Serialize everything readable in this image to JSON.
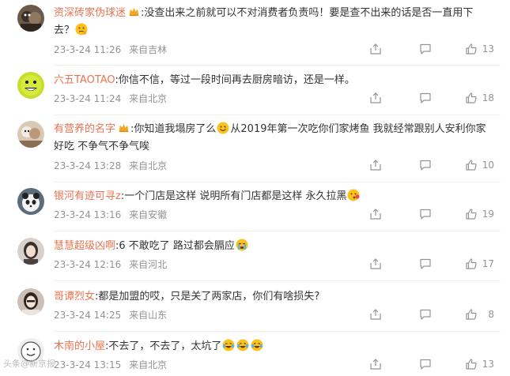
{
  "comments": [
    {
      "user": "资深砖家伪球迷",
      "verified": true,
      "text_parts": [
        ":没查出来之前就可以不对消费者负责吗！要是查不出来的话是否一直用下去？"
      ],
      "emojis_after": [
        "think-emoji"
      ],
      "timestamp": "23-3-24 11:26",
      "location": "来自吉林",
      "likes": "13",
      "avatar_color": "#6b5a48"
    },
    {
      "user": "六五TAOTAO",
      "verified": false,
      "text_parts": [
        ":你信不信，等过一段时间再去厨房暗访，还是一样。"
      ],
      "emojis_after": [],
      "timestamp": "23-3-24 11:24",
      "location": "来自北京",
      "likes": "18",
      "avatar_color": "#c8de2c"
    },
    {
      "user": "有营养的名字",
      "verified": true,
      "text_parts": [
        ":你知道我塌房了么",
        "从2019年第一次吃你们家烤鱼 我就经常跟别人安利你家好吃 不争气不争气唉"
      ],
      "emojis_after": [],
      "timestamp": "23-3-24 13:28",
      "location": "来自北京",
      "likes": "10",
      "avatar_color": "#d9c9b4"
    },
    {
      "user": "银河有迹可寻z",
      "verified": false,
      "text_parts": [
        ":一个门店是这样 说明所有门店都是这样 永久拉黑"
      ],
      "emojis_after": [
        "awkward-emoji"
      ],
      "timestamp": "23-3-24 13:16",
      "location": "来自安徽",
      "likes": "19",
      "avatar_color": "#5b6c7a"
    },
    {
      "user": "慧慧超级凶啊",
      "verified": false,
      "text_parts": [
        ":6 不敢吃了 路过都会膈应"
      ],
      "emojis_after": [
        "cry-emoji"
      ],
      "timestamp": "23-3-24 12:16",
      "location": "来自河北",
      "likes": "17",
      "avatar_color": "#4a4240"
    },
    {
      "user": "哥谭烈女",
      "verified": false,
      "text_parts": [
        ":都是加盟的哎，只是关了两家店，你们有啥损失?"
      ],
      "emojis_after": [],
      "timestamp": "23-3-24 14:25",
      "location": "来自山东",
      "likes": "8",
      "avatar_color": "#cbbfb6"
    },
    {
      "user": "木南的小屋",
      "verified": false,
      "text_parts": [
        ":不去了，不去了，太坑了"
      ],
      "emojis_after": [
        "laugh-cry-emoji",
        "laugh-cry-emoji",
        "laugh-cry-emoji"
      ],
      "timestamp": "23-3-24 13:15",
      "location": "来自北京",
      "likes": "13",
      "avatar_color": "#efefef"
    }
  ],
  "colors": {
    "username": "#eb7350",
    "text": "#333333",
    "meta": "#939393",
    "divider": "#eeeeee",
    "badge": "#f6a723"
  },
  "icons": [
    "share-icon",
    "comment-icon",
    "like-icon",
    "verified-badge-icon"
  ],
  "watermark": "头条@新京报"
}
